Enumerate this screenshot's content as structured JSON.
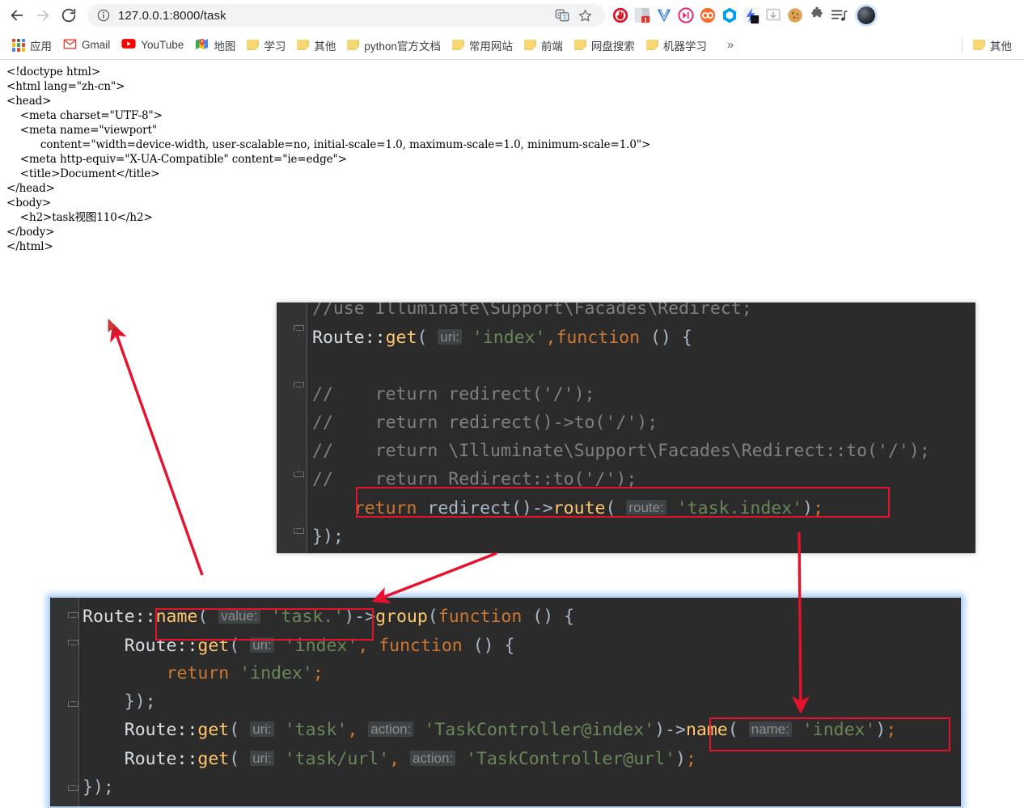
{
  "browser": {
    "back_label": "Back",
    "forward_label": "Forward",
    "reload_label": "Reload",
    "url": "127.0.0.1:8000/task",
    "url_host": "127.0.0.1",
    "url_rest": ":8000/task",
    "icons": {
      "back": "back-arrow-icon",
      "forward": "forward-arrow-icon",
      "reload": "reload-icon",
      "site_info": "site-info-icon",
      "translate": "translate-icon",
      "bookmark_star": "star-icon",
      "profile": "profile-avatar-icon"
    },
    "extensions": [
      {
        "name": "adblock-extension-icon",
        "color": "#e0152a"
      },
      {
        "name": "grammar-extension-icon",
        "color": "#b9bcc0"
      },
      {
        "name": "vimium-extension-icon",
        "color": "#3a7bd5"
      },
      {
        "name": "fastforward-extension-icon",
        "color": "#e8256f"
      },
      {
        "name": "infinity-extension-icon",
        "color": "#ff6a2b"
      },
      {
        "name": "hexagon-extension-icon",
        "color": "#00a0e9"
      },
      {
        "name": "lightning-extension-icon",
        "color": "#4b6bfb"
      },
      {
        "name": "download-extension-icon",
        "color": "#c6ccd2"
      },
      {
        "name": "cookie-extension-icon",
        "color": "#e0a458"
      },
      {
        "name": "puzzle-extensions-icon",
        "color": "#5f6368"
      },
      {
        "name": "playlist-extension-icon",
        "color": "#5f6368"
      }
    ]
  },
  "bookmarks": {
    "apps_label": "应用",
    "items": [
      {
        "label": "Gmail",
        "icon": "gmail-icon"
      },
      {
        "label": "YouTube",
        "icon": "youtube-icon"
      },
      {
        "label": "地图",
        "icon": "maps-icon"
      },
      {
        "label": "学习",
        "icon": "folder-icon"
      },
      {
        "label": "其他",
        "icon": "folder-icon"
      },
      {
        "label": "python官方文档",
        "icon": "folder-icon"
      },
      {
        "label": "常用网站",
        "icon": "folder-icon"
      },
      {
        "label": "前端",
        "icon": "folder-icon"
      },
      {
        "label": "网盘搜索",
        "icon": "folder-icon"
      },
      {
        "label": "机器学习",
        "icon": "folder-icon"
      }
    ],
    "overflow_label": "»",
    "right_item": {
      "label": "其他",
      "icon": "folder-icon"
    }
  },
  "page_source": "<!doctype html>\n<html lang=\"zh-cn\">\n<head>\n    <meta charset=\"UTF-8\">\n    <meta name=\"viewport\"\n          content=\"width=device-width, user-scalable=no, initial-scale=1.0, maximum-scale=1.0, minimum-scale=1.0\">\n    <meta http-equiv=\"X-UA-Compatible\" content=\"ie=edge\">\n    <title>Document</title>\n</head>\n<body>\n    <h2>task视图110</h2>\n</body>\n</html>",
  "code_top": {
    "lines": [
      {
        "id": "l1",
        "tokens": [
          {
            "t": "//use Illuminate\\Support\\Facades\\Redirect;",
            "c": "t-comment"
          }
        ]
      },
      {
        "id": "l2",
        "tokens": [
          {
            "t": "Route::",
            "c": "t-white"
          },
          {
            "t": "get",
            "c": "t-fn"
          },
          {
            "t": "( ",
            "c": "t-plain"
          },
          {
            "t": "uri:",
            "c": "hint"
          },
          {
            "t": " ",
            "c": "t-plain"
          },
          {
            "t": "'index'",
            "c": "t-str"
          },
          {
            "t": ",",
            "c": "t-semi"
          },
          {
            "t": "function",
            "c": "t-kw"
          },
          {
            "t": " () {",
            "c": "t-plain"
          }
        ]
      },
      {
        "id": "l3",
        "tokens": [
          {
            "t": "",
            "c": "t-plain"
          }
        ]
      },
      {
        "id": "l4",
        "tokens": [
          {
            "t": "//    return redirect('/');",
            "c": "t-comment"
          }
        ]
      },
      {
        "id": "l5",
        "tokens": [
          {
            "t": "//    return redirect()->to('/');",
            "c": "t-comment"
          }
        ]
      },
      {
        "id": "l6",
        "tokens": [
          {
            "t": "//    return \\Illuminate\\Support\\Facades\\Redirect::to('/');",
            "c": "t-comment"
          }
        ]
      },
      {
        "id": "l7",
        "tokens": [
          {
            "t": "//    return Redirect::to('/');",
            "c": "t-comment"
          }
        ]
      },
      {
        "id": "l8",
        "tokens": [
          {
            "t": "    ",
            "c": "t-plain"
          },
          {
            "t": "return",
            "c": "t-kw"
          },
          {
            "t": " redirect()->",
            "c": "t-plain"
          },
          {
            "t": "route",
            "c": "t-fn"
          },
          {
            "t": "( ",
            "c": "t-plain"
          },
          {
            "t": "route:",
            "c": "hint"
          },
          {
            "t": " ",
            "c": "t-plain"
          },
          {
            "t": "'task.index'",
            "c": "t-str"
          },
          {
            "t": ")",
            "c": "t-plain"
          },
          {
            "t": ";",
            "c": "t-semi"
          }
        ]
      },
      {
        "id": "l9",
        "tokens": [
          {
            "t": "});",
            "c": "t-plain"
          }
        ]
      }
    ],
    "highlight_label": "return redirect()->route( route: 'task.index');"
  },
  "code_bottom": {
    "lines": [
      {
        "id": "b1",
        "tokens": [
          {
            "t": "Route::",
            "c": "t-white"
          },
          {
            "t": "name",
            "c": "t-fn"
          },
          {
            "t": "( ",
            "c": "t-plain"
          },
          {
            "t": "value:",
            "c": "hint"
          },
          {
            "t": " ",
            "c": "t-plain"
          },
          {
            "t": "'task.'",
            "c": "t-str"
          },
          {
            "t": ")->",
            "c": "t-plain"
          },
          {
            "t": "group",
            "c": "t-fn"
          },
          {
            "t": "(",
            "c": "t-plain"
          },
          {
            "t": "function",
            "c": "t-kw"
          },
          {
            "t": " () {",
            "c": "t-plain"
          }
        ]
      },
      {
        "id": "b2",
        "tokens": [
          {
            "t": "    Route::",
            "c": "t-white"
          },
          {
            "t": "get",
            "c": "t-fn"
          },
          {
            "t": "( ",
            "c": "t-plain"
          },
          {
            "t": "uri:",
            "c": "hint"
          },
          {
            "t": " ",
            "c": "t-plain"
          },
          {
            "t": "'index'",
            "c": "t-str"
          },
          {
            "t": ", ",
            "c": "t-semi"
          },
          {
            "t": "function",
            "c": "t-kw"
          },
          {
            "t": " () {",
            "c": "t-plain"
          }
        ]
      },
      {
        "id": "b3",
        "tokens": [
          {
            "t": "        ",
            "c": "t-plain"
          },
          {
            "t": "return",
            "c": "t-kw"
          },
          {
            "t": " ",
            "c": "t-plain"
          },
          {
            "t": "'index'",
            "c": "t-str"
          },
          {
            "t": ";",
            "c": "t-semi"
          }
        ]
      },
      {
        "id": "b4",
        "tokens": [
          {
            "t": "    });",
            "c": "t-plain"
          }
        ]
      },
      {
        "id": "b5",
        "tokens": [
          {
            "t": "    Route::",
            "c": "t-white"
          },
          {
            "t": "get",
            "c": "t-fn"
          },
          {
            "t": "( ",
            "c": "t-plain"
          },
          {
            "t": "uri:",
            "c": "hint"
          },
          {
            "t": " ",
            "c": "t-plain"
          },
          {
            "t": "'task'",
            "c": "t-str"
          },
          {
            "t": ", ",
            "c": "t-semi"
          },
          {
            "t": "action:",
            "c": "hint"
          },
          {
            "t": " ",
            "c": "t-plain"
          },
          {
            "t": "'TaskController@index'",
            "c": "t-str"
          },
          {
            "t": ")->",
            "c": "t-plain"
          },
          {
            "t": "name",
            "c": "t-fn"
          },
          {
            "t": "( ",
            "c": "t-plain"
          },
          {
            "t": "name:",
            "c": "hint"
          },
          {
            "t": " ",
            "c": "t-plain"
          },
          {
            "t": "'index'",
            "c": "t-str"
          },
          {
            "t": ")",
            "c": "t-plain"
          },
          {
            "t": ";",
            "c": "t-semi"
          }
        ]
      },
      {
        "id": "b6",
        "tokens": [
          {
            "t": "    Route::",
            "c": "t-white"
          },
          {
            "t": "get",
            "c": "t-fn"
          },
          {
            "t": "( ",
            "c": "t-plain"
          },
          {
            "t": "uri:",
            "c": "hint"
          },
          {
            "t": " ",
            "c": "t-plain"
          },
          {
            "t": "'task/url'",
            "c": "t-str"
          },
          {
            "t": ", ",
            "c": "t-semi"
          },
          {
            "t": "action:",
            "c": "hint"
          },
          {
            "t": " ",
            "c": "t-plain"
          },
          {
            "t": "'TaskController@url'",
            "c": "t-str"
          },
          {
            "t": ")",
            "c": "t-plain"
          },
          {
            "t": ";",
            "c": "t-semi"
          }
        ]
      },
      {
        "id": "b7",
        "tokens": [
          {
            "t": "});",
            "c": "t-plain"
          }
        ]
      }
    ],
    "highlight_name_label": "name( value: 'task.')",
    "highlight_index_label": ">name( name: 'index');"
  },
  "annotations": {
    "accent_color": "#e8112d",
    "arrow_1": "arrow-from-route-group-to-page-source",
    "arrow_2": "arrow-from-redirect-route-to-group-name",
    "arrow_3": "arrow-from-route-name-to-index-name"
  }
}
